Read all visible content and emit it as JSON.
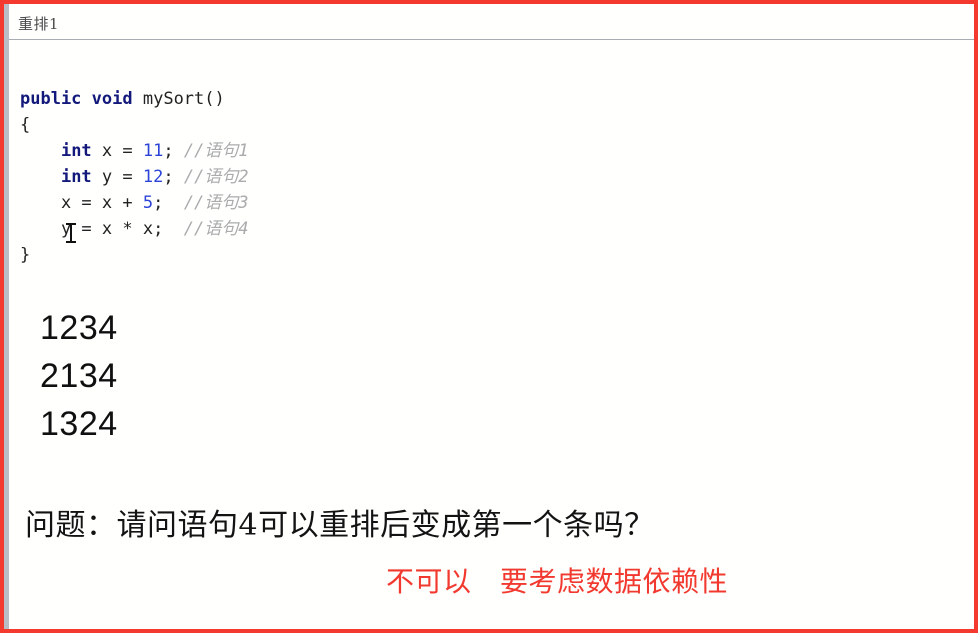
{
  "window": {
    "border_color": "#f4392f",
    "background": "#fffffd"
  },
  "header": {
    "title": "重排1"
  },
  "code_block": {
    "language": "java",
    "colors": {
      "keyword": "#12197a",
      "number": "#2b43d8",
      "comment": "#a9abad",
      "text": "#1a1a1a"
    },
    "lines": [
      {
        "indent": 0,
        "tokens": [
          {
            "t": "public",
            "k": "kw"
          },
          {
            "t": " ",
            "k": "plain"
          },
          {
            "t": "void",
            "k": "kw"
          },
          {
            "t": " mySort()",
            "k": "plain"
          }
        ]
      },
      {
        "indent": 0,
        "tokens": [
          {
            "t": "{",
            "k": "plain"
          }
        ]
      },
      {
        "indent": 1,
        "tokens": [
          {
            "t": "int",
            "k": "kw"
          },
          {
            "t": " x = ",
            "k": "plain"
          },
          {
            "t": "11",
            "k": "num"
          },
          {
            "t": "; ",
            "k": "plain"
          },
          {
            "t": "//语句1",
            "k": "cmt"
          }
        ]
      },
      {
        "indent": 1,
        "tokens": [
          {
            "t": "int",
            "k": "kw"
          },
          {
            "t": " y = ",
            "k": "plain"
          },
          {
            "t": "12",
            "k": "num"
          },
          {
            "t": "; ",
            "k": "plain"
          },
          {
            "t": "//语句2",
            "k": "cmt"
          }
        ]
      },
      {
        "indent": 1,
        "tokens": [
          {
            "t": "x = x + ",
            "k": "plain"
          },
          {
            "t": "5",
            "k": "num"
          },
          {
            "t": ";  ",
            "k": "plain"
          },
          {
            "t": "//语句3",
            "k": "cmt"
          }
        ]
      },
      {
        "indent": 1,
        "tokens": [
          {
            "t": "y = x * x;  ",
            "k": "plain"
          },
          {
            "t": "//语句4",
            "k": "cmt"
          }
        ]
      },
      {
        "indent": 0,
        "tokens": [
          {
            "t": "}",
            "k": "plain"
          }
        ]
      }
    ],
    "cursor": {
      "kind": "text-ibeam",
      "over_line": 6,
      "over_token": "y"
    }
  },
  "permutations": [
    "1234",
    "2134",
    "1324"
  ],
  "question": {
    "text": "问题：请问语句4可以重排后变成第一个条吗？"
  },
  "answer": {
    "text": "不可以　要考虑数据依赖性",
    "color": "#f2392f"
  }
}
